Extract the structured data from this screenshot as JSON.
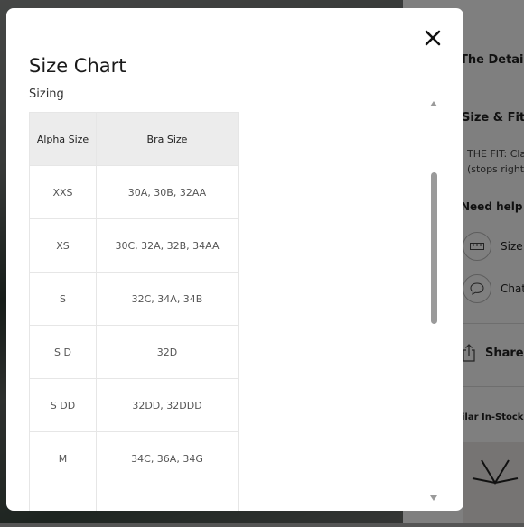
{
  "background": {
    "details_label": "The Details",
    "size_fit_label": "Size & Fit",
    "fit_text_1": "THE FIT: Cla",
    "fit_text_2": "(stops right",
    "need_help_label": "Need help fi",
    "size_link_label": "Size",
    "chat_link_label": "Chat",
    "share_label": "Share",
    "similar_label": "ilar In-Stock S"
  },
  "modal": {
    "title": "Size Chart",
    "section_label": "Sizing",
    "close_icon": "close-icon"
  },
  "size_table": {
    "headers": [
      "Alpha Size",
      "Bra Size"
    ],
    "rows": [
      [
        "XXS",
        "30A, 30B, 32AA"
      ],
      [
        "XS",
        "30C, 32A, 32B, 34AA"
      ],
      [
        "S",
        "32C, 34A, 34B"
      ],
      [
        "S D",
        "32D"
      ],
      [
        "S DD",
        "32DD, 32DDD"
      ],
      [
        "M",
        "34C, 36A, 34G"
      ],
      [
        "",
        ""
      ]
    ]
  },
  "colors": {
    "header_bg": "#ececec",
    "border": "#e6e6e6",
    "scroll_thumb": "#9a9a9a"
  }
}
